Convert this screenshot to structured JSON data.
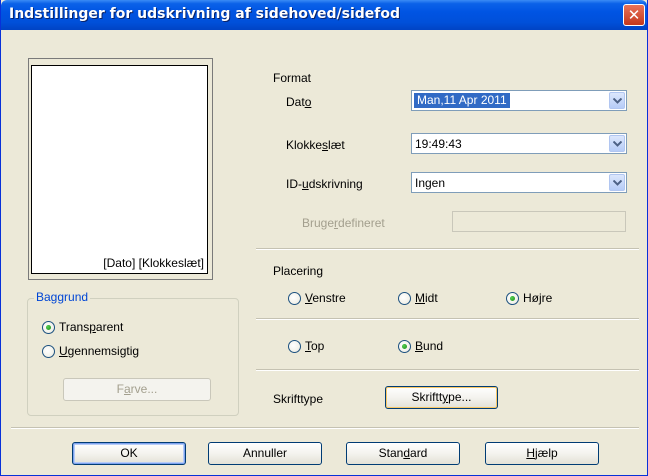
{
  "window": {
    "title": "Indstillinger for udskrivning af sidehoved/sidefod"
  },
  "preview": {
    "text": "[Dato] [Klokkeslæt]"
  },
  "background_group": {
    "title": "Baggrund",
    "options": [
      {
        "pre": "Trans",
        "key": "p",
        "post": "arent",
        "checked": true
      },
      {
        "pre": "",
        "key": "U",
        "post": "gennemsigtig",
        "checked": false
      }
    ],
    "color_button": {
      "pre": "F",
      "key": "a",
      "post": "rve..."
    }
  },
  "format": {
    "title": "Format",
    "date": {
      "pre": "Dat",
      "key": "o",
      "post": "",
      "value": "Man,11 Apr 2011"
    },
    "time": {
      "pre": "Klokke",
      "key": "s",
      "post": "læt",
      "value": "19:49:43"
    },
    "id": {
      "pre": "ID-",
      "key": "u",
      "post": "dskrivning",
      "value": "Ingen"
    },
    "custom": {
      "pre": "Bruge",
      "key": "r",
      "post": "defineret",
      "value": ""
    }
  },
  "placement": {
    "title": "Placering",
    "horizontal": [
      {
        "pre": "",
        "key": "V",
        "post": "enstre",
        "checked": false
      },
      {
        "pre": "",
        "key": "M",
        "post": "idt",
        "checked": false
      },
      {
        "pre": "Højre",
        "key": "",
        "post": "",
        "checked": true
      }
    ],
    "vertical": [
      {
        "pre": "",
        "key": "T",
        "post": "op",
        "checked": false
      },
      {
        "pre": "",
        "key": "B",
        "post": "und",
        "checked": true
      }
    ]
  },
  "font": {
    "label": "Skrifttype",
    "button": {
      "pre": "Skriftt",
      "key": "y",
      "post": "pe..."
    }
  },
  "buttons": {
    "ok": "OK",
    "cancel": "Annuller",
    "standard": {
      "pre": "Stan",
      "key": "d",
      "post": "ard"
    },
    "help": {
      "pre": "",
      "key": "H",
      "post": "jælp"
    }
  },
  "colors": {
    "titlebar": "#0054E3",
    "dialog": "#ECE9D8",
    "group_title": "#0046D5",
    "selection": "#316AC5"
  }
}
